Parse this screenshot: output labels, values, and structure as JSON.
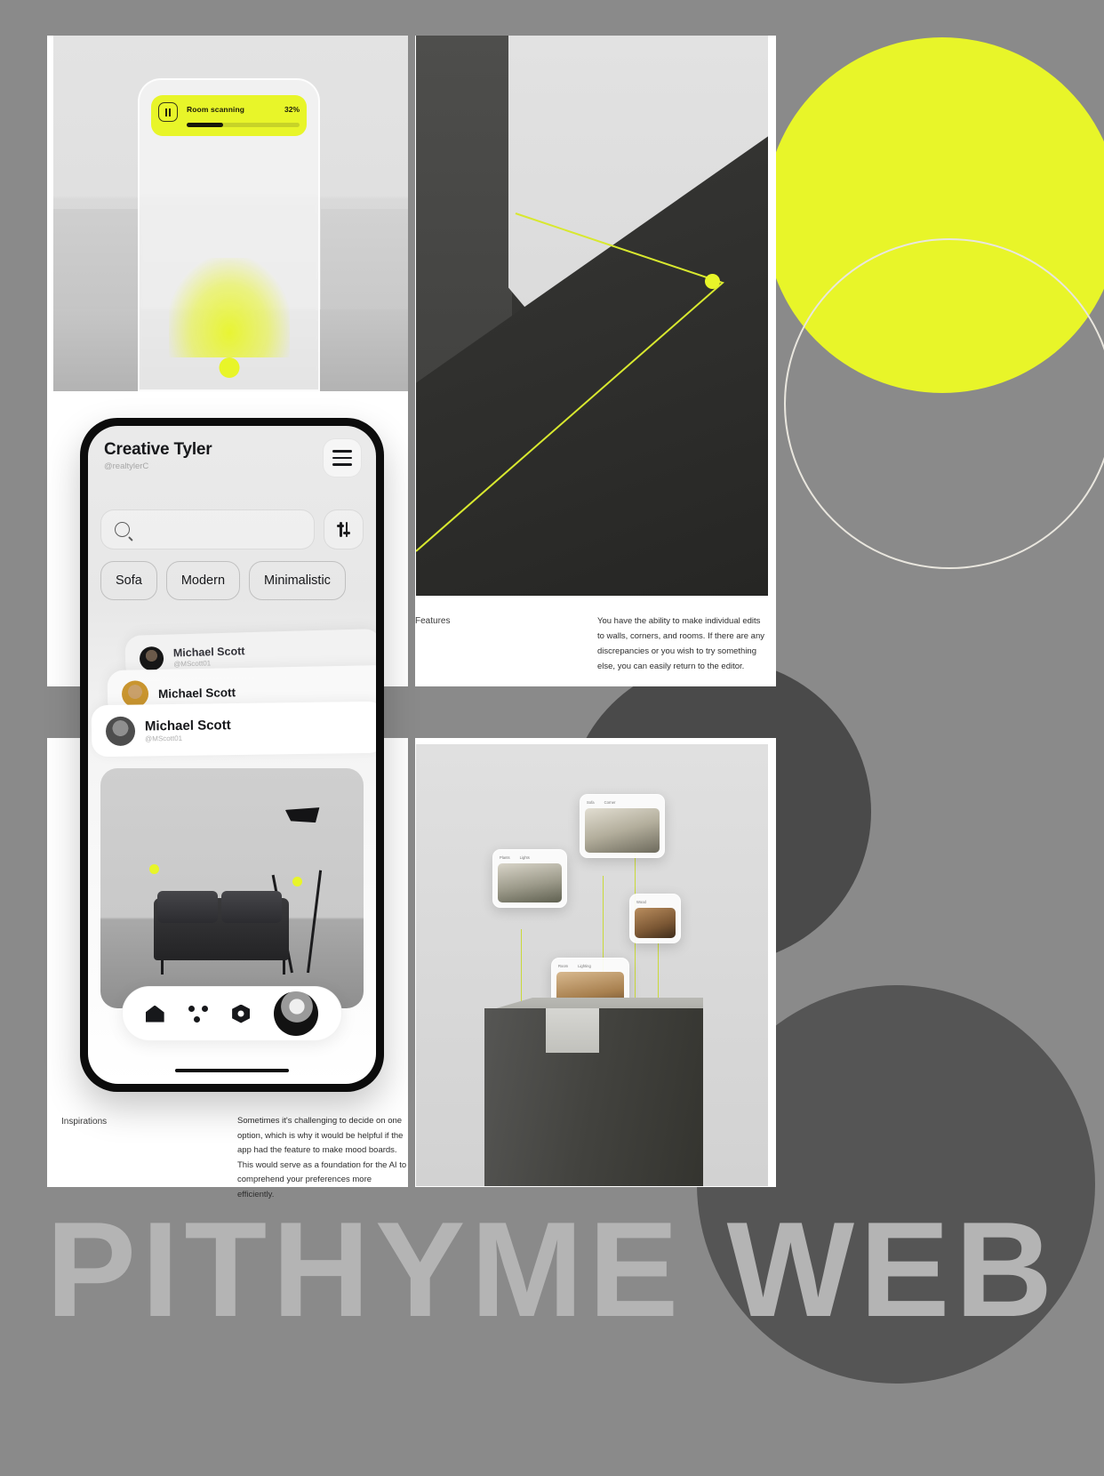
{
  "brand": {
    "wordmark": "PITHYME WEB",
    "accent_color": "#e8f529",
    "background_color": "#8a8a8a"
  },
  "scan_panel": {
    "pause_icon": "pause-icon",
    "status_label": "Room scanning",
    "progress_percent": "32%",
    "progress_value": 32
  },
  "features_section": {
    "label": "Features",
    "body": "You have the ability to make individual edits to walls, corners, and rooms. If there are any discrepancies or you wish to try something else, you can easily return to the editor."
  },
  "inspirations_section": {
    "label": "Inspirations",
    "body": "Sometimes it's challenging to decide on one option, which is why it would be helpful if the app had the feature to make mood boards. This would serve as a foundation for the AI to comprehend your preferences more efficiently."
  },
  "app": {
    "title": "Creative Tyler",
    "handle": "@realtylerC",
    "menu_icon": "hamburger-menu-icon",
    "search": {
      "placeholder": "",
      "value": "",
      "icon": "search-icon"
    },
    "filter_button_icon": "sliders-icon",
    "chips": [
      {
        "label": "Sofa"
      },
      {
        "label": "Modern"
      },
      {
        "label": "Minimalistic"
      }
    ],
    "user_cards": [
      {
        "name": "Michael Scott",
        "handle": "@MScott01"
      },
      {
        "name": "Michael Scott",
        "handle": ""
      },
      {
        "name": "Michael Scott",
        "handle": "@MScott01"
      }
    ],
    "nav": [
      {
        "label": "Home",
        "icon": "home-icon"
      },
      {
        "label": "Discover",
        "icon": "dots-grid-icon"
      },
      {
        "label": "Settings",
        "icon": "gear-icon"
      },
      {
        "label": "Profile",
        "icon": "avatar-icon"
      }
    ]
  },
  "boards_panel": {
    "cards": [
      {
        "tab_a": "Plants",
        "tab_b": "Lights"
      },
      {
        "tab_a": "Sofa",
        "tab_b": "Corner"
      },
      {
        "tab_a": "Wood",
        "tab_b": ""
      },
      {
        "tab_a": "Room",
        "tab_b": "Lighting"
      }
    ]
  }
}
